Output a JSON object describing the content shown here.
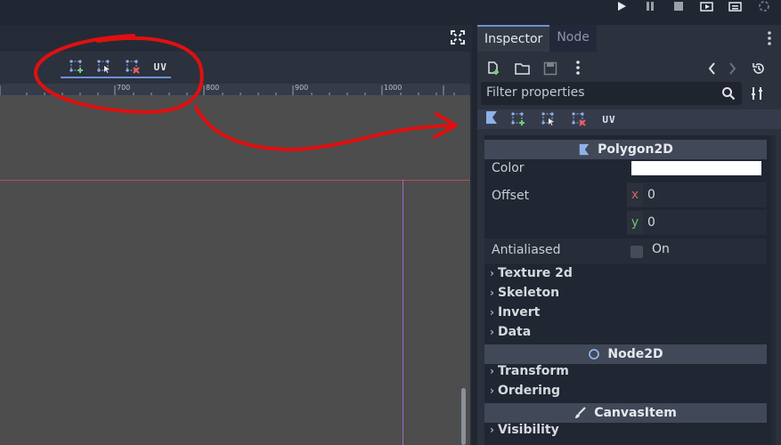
{
  "playbar": {
    "icons": [
      "play-icon",
      "pause-icon",
      "stop-icon",
      "play-scene-icon",
      "play-custom-icon",
      "loading-icon"
    ]
  },
  "viewport": {
    "toolbar": {
      "uv_label": "UV"
    },
    "ruler": {
      "labels": [
        "700",
        "800",
        "900",
        "1000"
      ]
    }
  },
  "inspector": {
    "tabs": [
      {
        "label": "Inspector",
        "active": true
      },
      {
        "label": "Node",
        "active": false
      }
    ],
    "filter_placeholder": "Filter properties",
    "uv_label": "UV",
    "sections": {
      "polygon": "Polygon2D",
      "node2d": "Node2D",
      "canvasitem": "CanvasItem"
    },
    "props": {
      "color_label": "Color",
      "color_value": "#ffffff",
      "offset_label": "Offset",
      "offset_x_axis": "x",
      "offset_x": "0",
      "offset_y_axis": "y",
      "offset_y": "0",
      "antialiased_label": "Antialiased",
      "antialiased_value": "On"
    },
    "groups_polygon": [
      "Texture 2d",
      "Skeleton",
      "Invert",
      "Data"
    ],
    "groups_node2d": [
      "Transform",
      "Ordering"
    ],
    "groups_canvasitem": [
      "Visibility"
    ]
  },
  "colors": {
    "accent": "#6d8fd6",
    "annotation": "#e01010"
  }
}
